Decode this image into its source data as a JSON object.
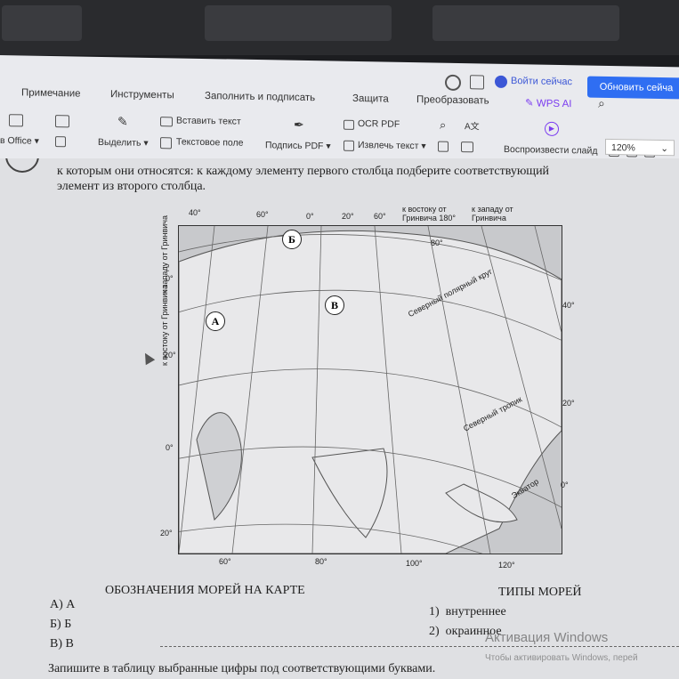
{
  "account": {
    "login_label": "Войти сейчас",
    "upgrade_label": "Обновить сейча"
  },
  "menu": [
    "Примечание",
    "Инструменты",
    "Заполнить и подписать",
    "Защита",
    "Преобразовать",
    "WPS AI"
  ],
  "ribbon": {
    "office_label": "в Office",
    "select_label": "Выделить",
    "insert_text_label": "Вставить текст",
    "text_field_label": "Текстовое поле",
    "sign_pdf_label": "Подпись PDF",
    "ocr_label": "OCR PDF",
    "extract_text_label": "Извлечь текст",
    "slideshow_label": "Воспроизвести слайд",
    "zoom": "120%"
  },
  "doc": {
    "instruction_line1": "к которым они относятся: к каждому элементу первого столбца подберите соответствующий",
    "instruction_line2": "элемент из второго столбца.",
    "map": {
      "top_labels": [
        "40°",
        "60°",
        "0°",
        "20°",
        "60°"
      ],
      "east_label": "к востоку от Гринвича 180°",
      "west_label": "к западу от Гринвича",
      "left_vertical_west": "к западу от Гринвича",
      "left_vertical_east": "к востоку от Гринвича",
      "left_zero": "0°",
      "left_labels": [
        "20°",
        "0°",
        "20°"
      ],
      "right_labels": [
        "40°",
        "20°",
        "0°"
      ],
      "bottom_labels": [
        "60°",
        "80°",
        "100°",
        "120°"
      ],
      "lat_80": "80°",
      "polar_circle": "Северный полярный круг",
      "tropic": "Северный тропик",
      "equator": "Экватор",
      "markers": [
        "А",
        "Б",
        "В"
      ]
    },
    "left_heading": "ОБОЗНАЧЕНИЯ МОРЕЙ НА КАРТЕ",
    "right_heading": "ТИПЫ МОРЕЙ",
    "left_items": [
      {
        "letter": "А)",
        "value": "А"
      },
      {
        "letter": "Б)",
        "value": "Б"
      },
      {
        "letter": "В)",
        "value": "В"
      }
    ],
    "right_items": [
      {
        "num": "1)",
        "value": "внутреннее"
      },
      {
        "num": "2)",
        "value": "окраинное"
      }
    ],
    "bottom_text": "Запишите в таблицу выбранные цифры под соответствующими буквами."
  },
  "watermark": {
    "title": "Активация Windows",
    "subtitle": "Чтобы активировать Windows, перей"
  }
}
